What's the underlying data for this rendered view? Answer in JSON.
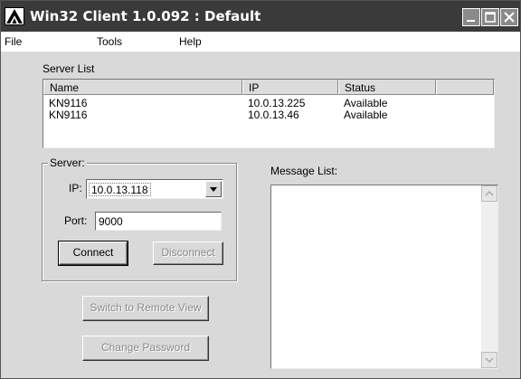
{
  "window": {
    "title": "Win32 Client 1.0.092 : Default"
  },
  "icons": {
    "app": "app-logo-icon",
    "minimize": "minimize-icon",
    "maximize": "maximize-icon",
    "close": "close-icon",
    "dropdown": "chevron-down-icon",
    "scroll_up": "scroll-up-arrow-icon",
    "scroll_down": "scroll-down-arrow-icon"
  },
  "menu": {
    "file": "File",
    "tools": "Tools",
    "help": "Help"
  },
  "server_list": {
    "label": "Server List",
    "columns": [
      "Name",
      "IP",
      "Status",
      ""
    ],
    "rows": [
      {
        "name": "KN9116",
        "ip": "10.0.13.225",
        "status": "Available"
      },
      {
        "name": "KN9116",
        "ip": "10.0.13.46",
        "status": "Available"
      }
    ]
  },
  "server_group": {
    "legend": "Server:",
    "ip_label": "IP:",
    "ip_value": "10.0.13.118",
    "port_label": "Port:",
    "port_value": "9000",
    "connect": "Connect",
    "disconnect": "Disconnect"
  },
  "actions": {
    "switch_remote": "Switch to Remote View",
    "change_password": "Change Password"
  },
  "message_list": {
    "label": "Message List:"
  }
}
